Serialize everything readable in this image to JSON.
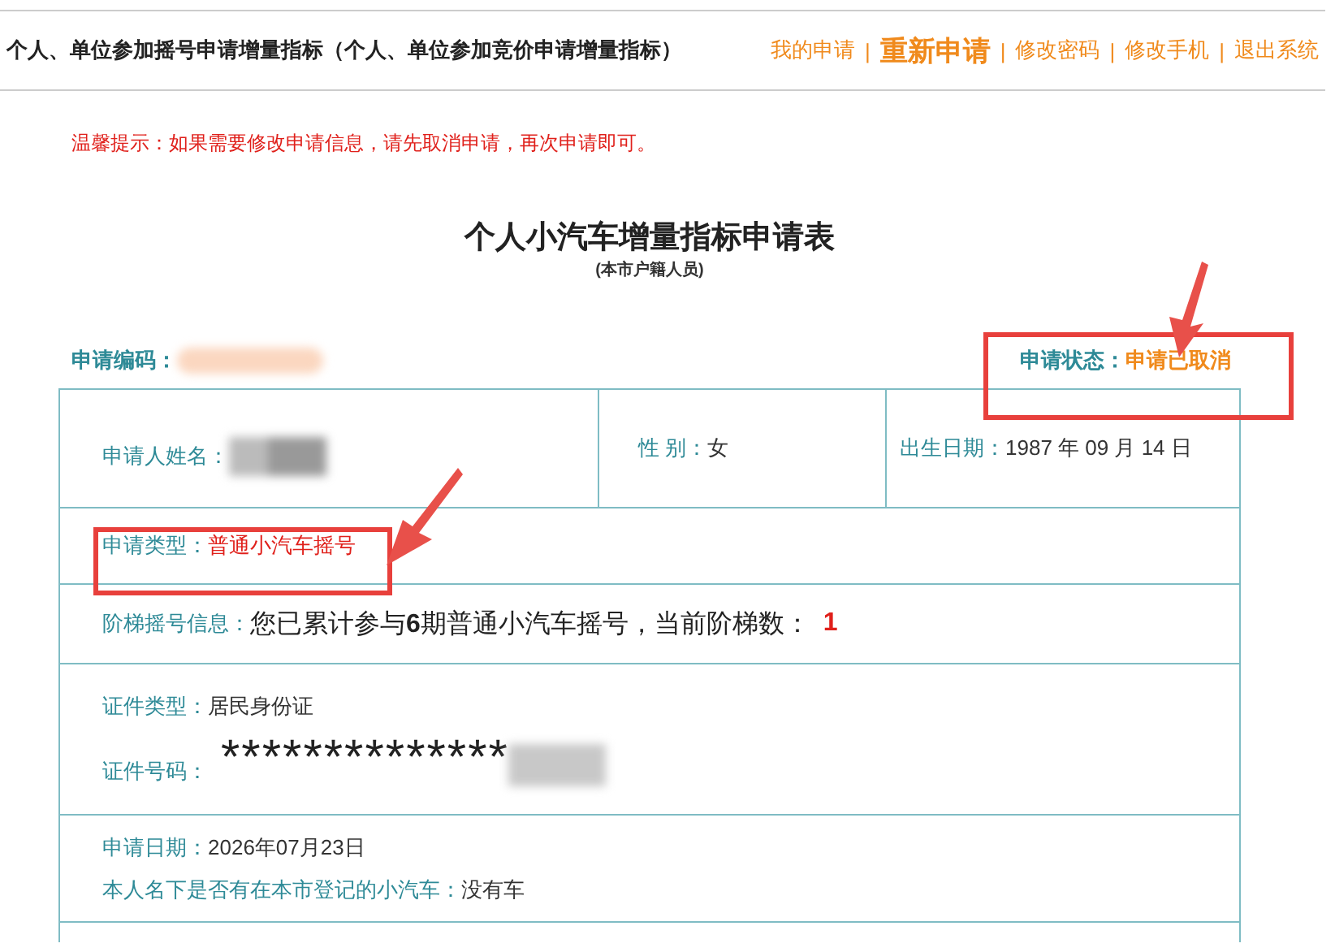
{
  "header": {
    "title": "个人、单位参加摇号申请增量指标（个人、单位参加竞价申请增量指标）",
    "links": [
      {
        "kind": "link",
        "text": "我的申请"
      },
      {
        "kind": "separator",
        "text": "|"
      },
      {
        "kind": "primary",
        "text": "重新申请"
      },
      {
        "kind": "separator",
        "text": "|"
      },
      {
        "kind": "link",
        "text": "修改密码"
      },
      {
        "kind": "separator",
        "text": "|"
      },
      {
        "kind": "link",
        "text": "修改手机"
      },
      {
        "kind": "separator",
        "text": "|"
      },
      {
        "kind": "link",
        "text": "退出系统"
      }
    ]
  },
  "notice": "温馨提示：如果需要修改申请信息，请先取消申请，再次申请即可。",
  "form": {
    "title": "个人小汽车增量指标申请表",
    "subtitle": "(本市户籍人员)",
    "code_label": "申请编码：",
    "status_label": "申请状态：",
    "status_value": "申请已取消",
    "name_label": "申请人姓名：",
    "gender_label": "性 别：",
    "gender_value": "女",
    "birth_label": "出生日期：",
    "birth_value": "1987 年 09 月 14 日",
    "type_label": "申请类型：",
    "type_value": "普通小汽车摇号",
    "ladder_label": "阶梯摇号信息：",
    "ladder_text": "您已累计参与**6**期普通小汽车摇号，当前阶梯数：",
    "ladder_value": "1",
    "id_type_label": "证件类型：",
    "id_type_value": "居民身份证",
    "id_number_label": "证件号码：",
    "id_number_value": "**************",
    "date_label": "申请日期：",
    "date_value": "2026年07月23日",
    "car_label": "本人名下是否有在本市登记的小汽车：",
    "car_value": "没有车"
  }
}
